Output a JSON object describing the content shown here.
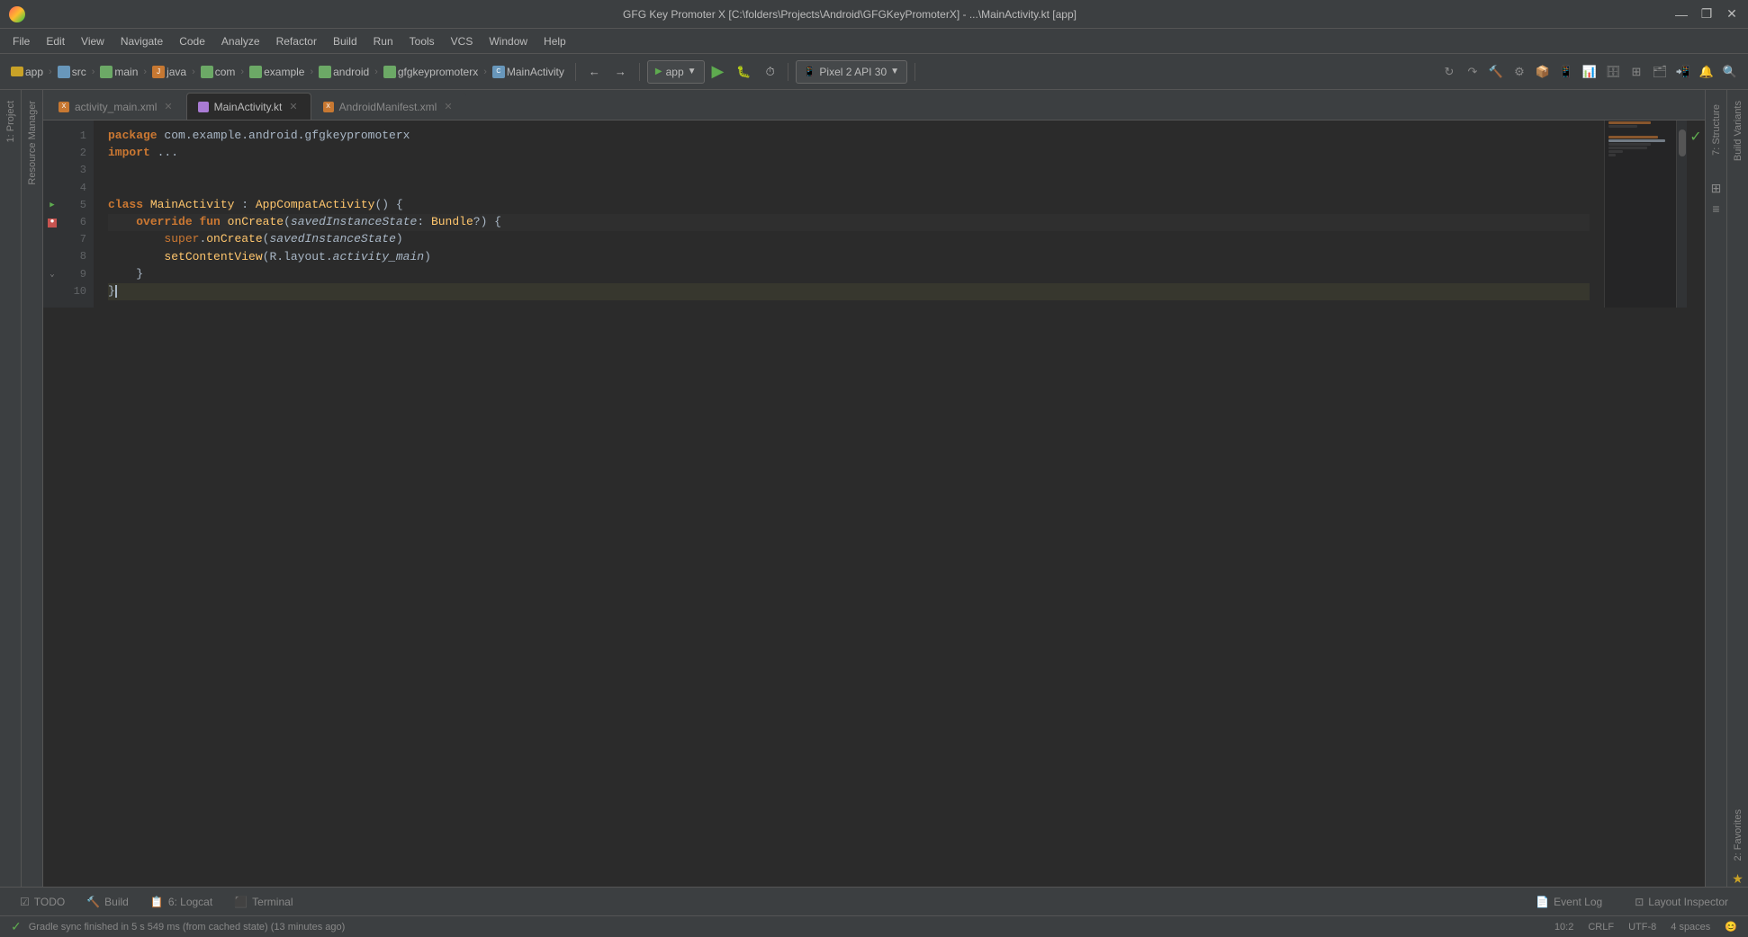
{
  "titlebar": {
    "title": "GFG Key Promoter X [C:\\folders\\Projects\\Android\\GFGKeyPromoterX] - ...\\MainActivity.kt [app]",
    "minimize": "—",
    "maximize": "❐",
    "close": "✕"
  },
  "menu": {
    "items": [
      "File",
      "Edit",
      "View",
      "Navigate",
      "Code",
      "Analyze",
      "Refactor",
      "Build",
      "Run",
      "Tools",
      "VCS",
      "Window",
      "Help"
    ]
  },
  "toolbar": {
    "app_label": "app",
    "device": "Pixel 2 API 30",
    "breadcrumb": [
      "app",
      "src",
      "main",
      "java",
      "com",
      "example",
      "android",
      "gfgkeypromoterx",
      "MainActivity"
    ]
  },
  "tabs": [
    {
      "name": "activity_main.xml",
      "type": "xml",
      "active": false
    },
    {
      "name": "MainActivity.kt",
      "type": "kt",
      "active": true
    },
    {
      "name": "AndroidManifest.xml",
      "type": "xml",
      "active": false
    }
  ],
  "code": {
    "lines": [
      {
        "num": 1,
        "text": "package com.example.android.gfgkeypromoterx"
      },
      {
        "num": 2,
        "text": "import ..."
      },
      {
        "num": 3,
        "text": ""
      },
      {
        "num": 4,
        "text": ""
      },
      {
        "num": 5,
        "text": "class MainActivity : AppCompatActivity() {"
      },
      {
        "num": 6,
        "text": "    override fun onCreate(savedInstanceState: Bundle?) {"
      },
      {
        "num": 7,
        "text": "        super.onCreate(savedInstanceState)"
      },
      {
        "num": 8,
        "text": "        setContentView(R.layout.activity_main)"
      },
      {
        "num": 9,
        "text": "    }"
      },
      {
        "num": 10,
        "text": "}"
      }
    ]
  },
  "left_panels": {
    "project": "1: Project",
    "resource_manager": "Resource Manager",
    "structure": "7: Structure",
    "build_variants": "Build Variants",
    "favorites": "2: Favorites"
  },
  "bottom_tabs": {
    "todo": "TODO",
    "build": "Build",
    "logcat": "6: Logcat",
    "terminal": "Terminal"
  },
  "status_bar": {
    "message": "Gradle sync finished in 5 s 549 ms (from cached state) (13 minutes ago)",
    "position": "10:2",
    "encoding": "CRLF",
    "charset": "UTF-8",
    "indent": "4 spaces"
  },
  "bottom_right": {
    "event_log": "Event Log",
    "layout_inspector": "Layout Inspector"
  },
  "icons": {
    "run": "▶",
    "debug": "🐞",
    "stop": "■",
    "sync": "↻",
    "search": "🔍",
    "settings": "⚙",
    "chevron": "›",
    "folder": "📁",
    "warning": "⚠",
    "info": "ℹ",
    "ok": "✓"
  }
}
